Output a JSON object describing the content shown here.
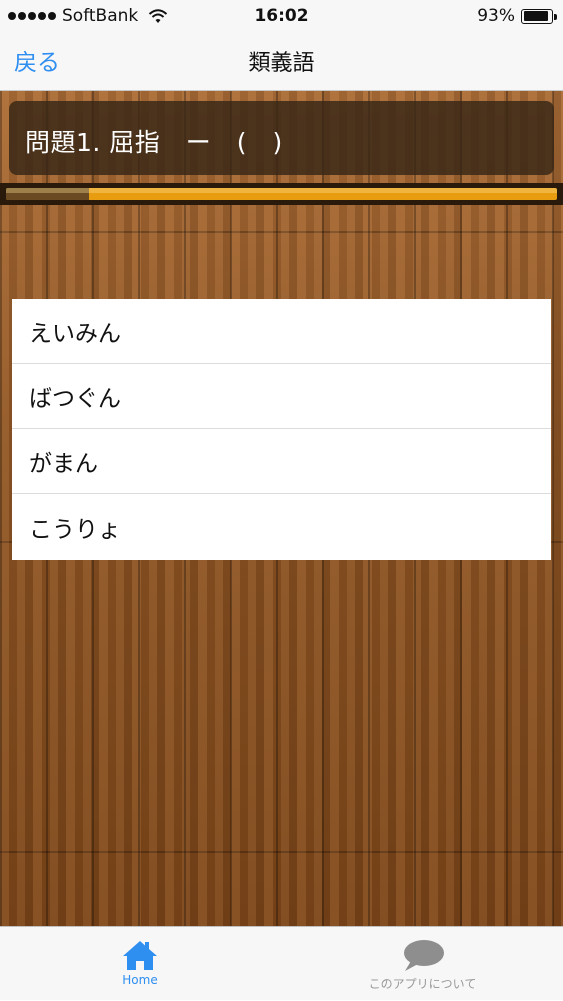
{
  "status_bar": {
    "carrier": "SoftBank",
    "time": "16:02",
    "battery": "93%",
    "battery_level": 0.93
  },
  "nav": {
    "back_label": "戻る",
    "title": "類義語"
  },
  "question": {
    "text": "問題1. 屈指　ー　(　)"
  },
  "progress": {
    "fraction": 0.15
  },
  "answers": [
    {
      "label": "えいみん"
    },
    {
      "label": "ばつぐん"
    },
    {
      "label": "がまん"
    },
    {
      "label": "こうりょ"
    }
  ],
  "tabs": [
    {
      "label": "Home",
      "icon": "home-icon",
      "selected": true
    },
    {
      "label": "このアプリについて",
      "icon": "speech-bubble-icon",
      "selected": false
    }
  ],
  "colors": {
    "accent": "#2e8ff0",
    "progress": "#e89c10",
    "inactive_tab": "#9a9a9a"
  }
}
